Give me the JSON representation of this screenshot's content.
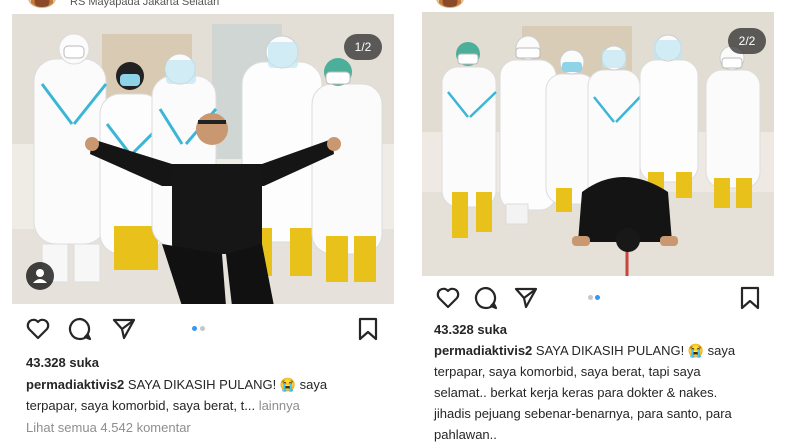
{
  "posts": [
    {
      "location": "RS Mayapada Jakarta Selatan",
      "counter": "1/2",
      "likes": "43.328 suka",
      "username": "permadiaktivis2",
      "caption_lines": [
        "SAYA DIKASIH PULANG! 😭 saya",
        "terpapar, saya komorbid, saya berat, t..."
      ],
      "more": "lainnya",
      "comments": "Lihat semua 4.542 komentar",
      "icons": [
        "heart-icon",
        "comment-icon",
        "share-icon",
        "bookmark-icon",
        "user-tag-icon"
      ]
    },
    {
      "counter": "2/2",
      "likes": "43.328 suka",
      "username": "permadiaktivis2",
      "caption_lines": [
        "SAYA DIKASIH PULANG! 😭 saya",
        "terpapar, saya komorbid, saya berat, tapi saya",
        "selamat.. berkat kerja keras para dokter & nakes.",
        "jihadis pejuang sebenar-benarnya, para santo, para",
        "pahlawan.."
      ],
      "icons": [
        "heart-icon",
        "comment-icon",
        "share-icon",
        "bookmark-icon"
      ]
    }
  ],
  "colors": {
    "dot_active": "#3897f0",
    "dot_inactive": "#c7c7c7",
    "text": "#262626",
    "muted": "#8e8e8e",
    "ppe_trim": "#3bb6d6",
    "boots": "#e8c21a"
  }
}
